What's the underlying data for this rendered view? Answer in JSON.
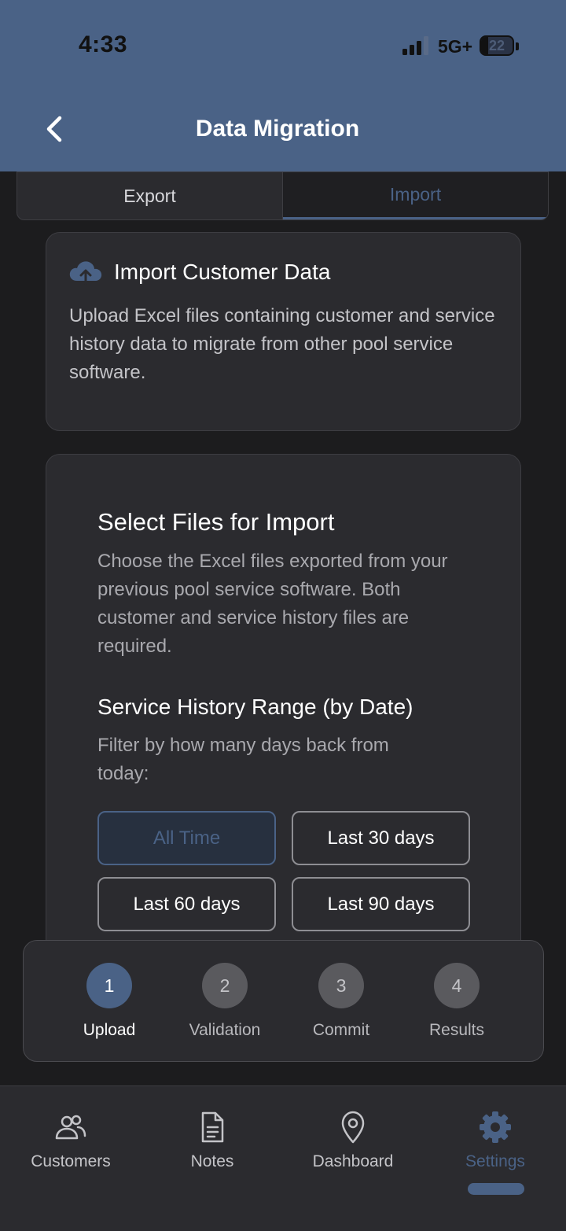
{
  "status": {
    "time": "4:33",
    "network": "5G+",
    "battery": "22"
  },
  "nav": {
    "title": "Data Migration",
    "back_icon": "chevron-left-icon"
  },
  "tabs": [
    {
      "label": "Export"
    },
    {
      "label": "Import",
      "selected": true
    }
  ],
  "intro_card": {
    "icon": "cloud-upload-icon",
    "title": "Import Customer Data",
    "description": "Upload Excel files containing customer and service history data to migrate from other pool service software."
  },
  "select_card": {
    "title": "Select Files for Import",
    "description": "Choose the Excel files exported from your previous pool service software. Both customer and service history files are required.",
    "range_title": "Service History Range (by Date)",
    "range_description": "Filter by how many days back from today:",
    "options": [
      {
        "label": "All Time",
        "selected": true
      },
      {
        "label": "Last 30 days"
      },
      {
        "label": "Last 60 days"
      },
      {
        "label": "Last 90 days"
      }
    ]
  },
  "stepper": [
    {
      "number": "1",
      "label": "Upload",
      "active": true
    },
    {
      "number": "2",
      "label": "Validation"
    },
    {
      "number": "3",
      "label": "Commit"
    },
    {
      "number": "4",
      "label": "Results"
    }
  ],
  "tabbar": [
    {
      "label": "Customers",
      "icon": "users-icon"
    },
    {
      "label": "Notes",
      "icon": "document-icon"
    },
    {
      "label": "Dashboard",
      "icon": "map-pin-icon"
    },
    {
      "label": "Settings",
      "icon": "gear-icon",
      "active": true
    }
  ],
  "colors": {
    "accent": "#4a6286",
    "background": "#1c1c1e",
    "card": "#2b2b2f"
  }
}
